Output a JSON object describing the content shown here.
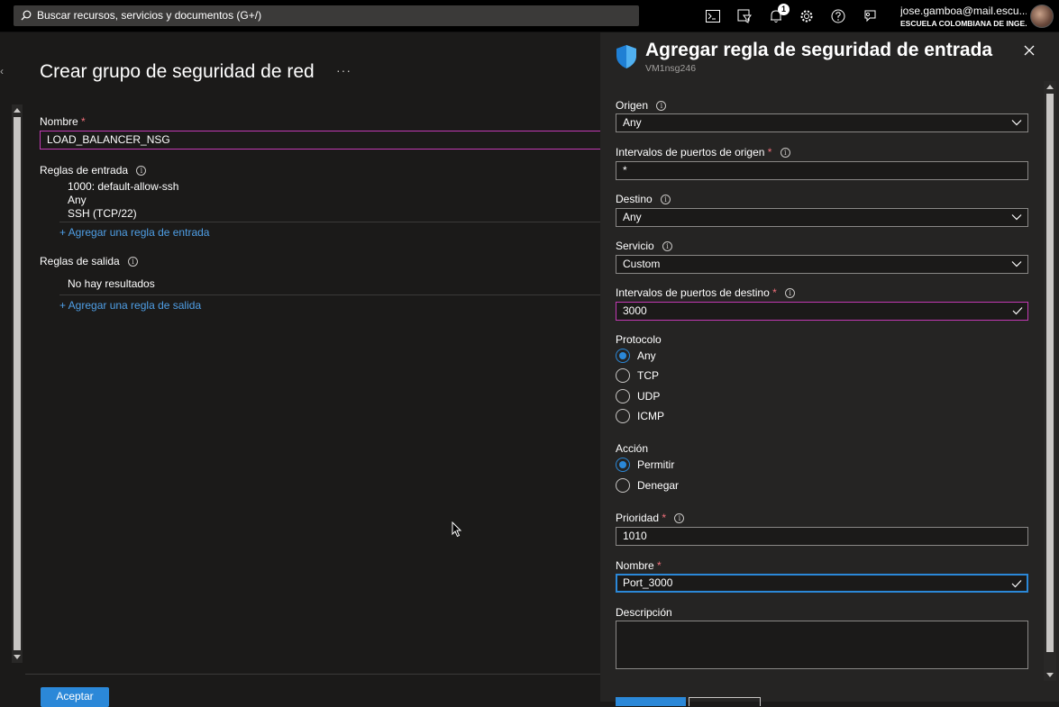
{
  "topbar": {
    "search_placeholder": "Buscar recursos, servicios y documentos (G+/)",
    "notification_count": "1",
    "user_email": "jose.gamboa@mail.escu...",
    "user_org": "ESCUELA COLOMBIANA DE INGE..."
  },
  "blade": {
    "title": "Crear grupo de seguridad de red",
    "more": "···",
    "name_label": "Nombre",
    "required_mark": "*",
    "name_value": "LOAD_BALANCER_NSG",
    "inbound_label": "Reglas de entrada",
    "inbound_rule": {
      "name": "1000: default-allow-ssh",
      "source": "Any",
      "service": "SSH (TCP/22)"
    },
    "add_inbound_link": "+ Agregar una regla de entrada",
    "outbound_label": "Reglas de salida",
    "outbound_empty": "No hay resultados",
    "add_outbound_link": "+ Agregar una regla de salida",
    "accept_button": "Aceptar"
  },
  "panel": {
    "title": "Agregar regla de seguridad de entrada",
    "subtitle": "VM1nsg246",
    "origen_label": "Origen",
    "origen_value": "Any",
    "origin_ports_label": "Intervalos de puertos de origen",
    "origin_ports_value": "*",
    "destino_label": "Destino",
    "destino_value": "Any",
    "servicio_label": "Servicio",
    "servicio_value": "Custom",
    "dest_ports_label": "Intervalos de puertos de destino",
    "dest_ports_value": "3000",
    "protocolo_label": "Protocolo",
    "protocol_options": [
      "Any",
      "TCP",
      "UDP",
      "ICMP"
    ],
    "protocol_selected": "Any",
    "accion_label": "Acción",
    "action_options": [
      "Permitir",
      "Denegar"
    ],
    "action_selected": "Permitir",
    "prioridad_label": "Prioridad",
    "prioridad_value": "1010",
    "nombre_label": "Nombre",
    "nombre_value": "Port_3000",
    "descripcion_label": "Descripción",
    "required_mark": "*"
  },
  "colors": {
    "accent_blue": "#2b88d8",
    "focus_purple": "#c239b3",
    "link_blue": "#4f9fe6",
    "required_red": "#f1707b"
  }
}
